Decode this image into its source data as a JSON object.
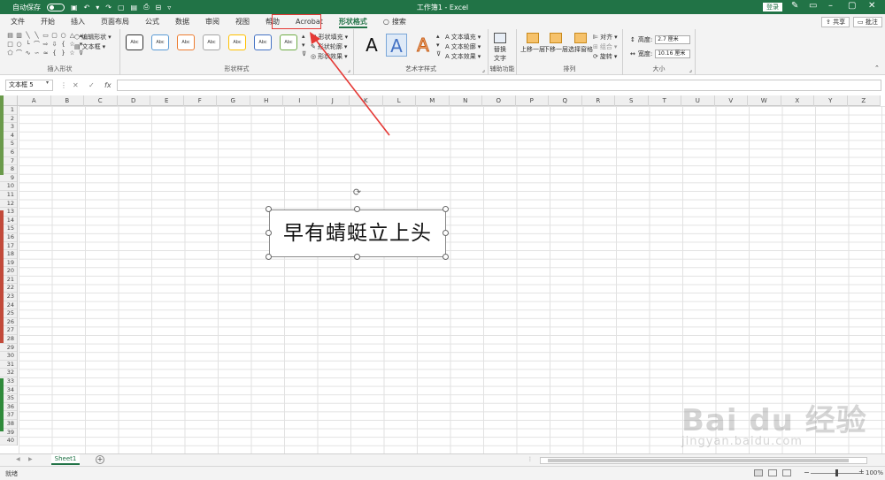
{
  "titlebar": {
    "autosave_label": "自动保存",
    "doc_title": "工作簿1 - Excel",
    "login_label": "登录"
  },
  "tabs": [
    "文件",
    "开始",
    "插入",
    "页面布局",
    "公式",
    "数据",
    "审阅",
    "视图",
    "帮助",
    "Acrobat",
    "形状格式"
  ],
  "active_tab": "形状格式",
  "search_label": "搜索",
  "share_label": "共享",
  "comment_label": "批注",
  "ribbon": {
    "insert_shapes": {
      "edit_shape": "编辑形状",
      "text_box": "文本框",
      "label": "插入形状"
    },
    "shape_styles": {
      "samples": [
        "Abc",
        "Abc",
        "Abc",
        "Abc",
        "Abc",
        "Abc",
        "Abc"
      ],
      "sample_colors": [
        "#333333",
        "#5b9bd5",
        "#ed7d31",
        "#a5a5a5",
        "#ffc000",
        "#4472c4",
        "#70ad47"
      ],
      "fill": "形状填充",
      "outline": "形状轮廓",
      "effect": "形状效果",
      "label": "形状样式"
    },
    "wordart": {
      "letters": [
        "A",
        "A",
        "A"
      ],
      "text_fill": "文本填充",
      "text_outline": "文本轮廓",
      "text_effect": "文本效果",
      "label": "艺术字样式"
    },
    "accessibility": {
      "alt_text_line1": "替换",
      "alt_text_line2": "文字",
      "label": "辅助功能"
    },
    "arrange": {
      "bring_forward": "上移一层",
      "send_backward": "下移一层",
      "selection_pane": "选择窗格",
      "align": "对齐",
      "group": "组合",
      "rotate": "旋转",
      "label": "排列"
    },
    "size": {
      "height_label": "高度:",
      "height_value": "2.7 厘米",
      "width_label": "宽度:",
      "width_value": "10.16 厘米",
      "label": "大小"
    }
  },
  "formula_bar": {
    "name_box": "文本框 5",
    "fx": "fx"
  },
  "columns": [
    "A",
    "B",
    "C",
    "D",
    "E",
    "F",
    "G",
    "H",
    "I",
    "J",
    "K",
    "L",
    "M",
    "N",
    "O",
    "P",
    "Q",
    "R",
    "S",
    "T",
    "U",
    "V",
    "W",
    "X",
    "Y",
    "Z"
  ],
  "rows": [
    "1",
    "2",
    "3",
    "4",
    "5",
    "6",
    "7",
    "8",
    "9",
    "10",
    "11",
    "12",
    "13",
    "14",
    "15",
    "16",
    "17",
    "18",
    "19",
    "20",
    "21",
    "22",
    "23",
    "24",
    "25",
    "26",
    "27",
    "28",
    "29",
    "30",
    "31",
    "32",
    "33",
    "34",
    "35",
    "36",
    "37",
    "38",
    "39",
    "40"
  ],
  "textbox": {
    "text": "早有蜻蜓立上头"
  },
  "sheets": {
    "active": "Sheet1"
  },
  "status": {
    "text": "就绪",
    "zoom": "100%"
  },
  "watermark": {
    "main": "Bai du 经验",
    "sub": "jingyan.baidu.com"
  },
  "colors": {
    "accent": "#217346",
    "annotation": "#e53935"
  }
}
